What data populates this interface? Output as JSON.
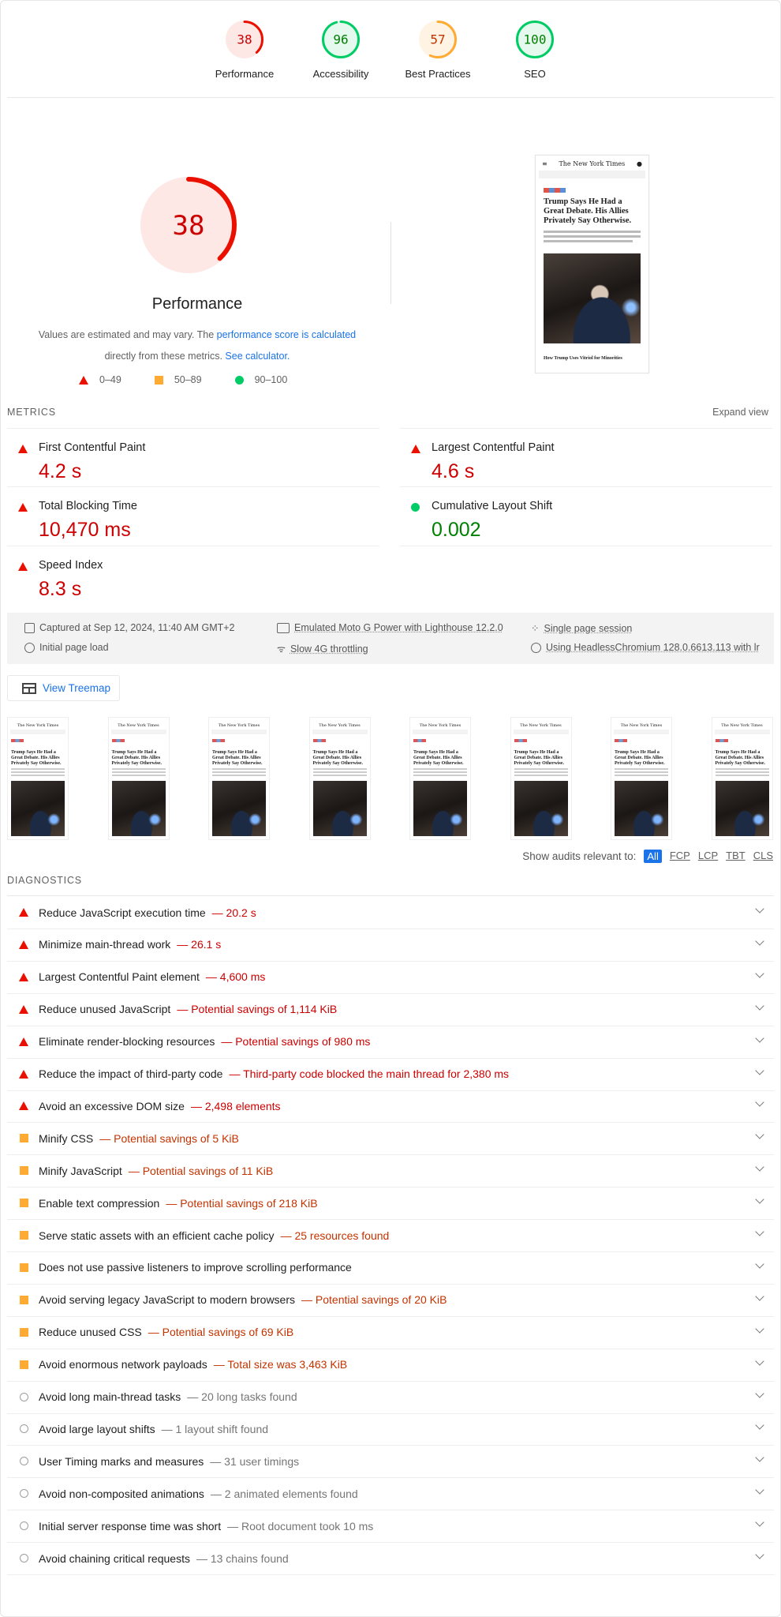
{
  "categories": [
    {
      "label": "Performance",
      "score": 38,
      "color": "#eb0f00",
      "bg": "#fde8e6",
      "text": "#c00"
    },
    {
      "label": "Accessibility",
      "score": 96,
      "color": "#0c6",
      "bg": "#e6f9ee",
      "text": "#008000"
    },
    {
      "label": "Best Practices",
      "score": 57,
      "color": "#fa3",
      "bg": "#fff4e4",
      "text": "#c33300"
    },
    {
      "label": "SEO",
      "score": 100,
      "color": "#0c6",
      "bg": "#e6f9ee",
      "text": "#008000"
    }
  ],
  "performance": {
    "score": 38,
    "title": "Performance",
    "desc_prefix": "Values are estimated and may vary. The ",
    "desc_link": "performance score is calculated",
    "desc_mid": "directly from these metrics.",
    "desc_link2": "See calculator.",
    "legend": [
      "0–49",
      "50–89",
      "90–100"
    ]
  },
  "screenshot": {
    "masthead": "The New York Times",
    "headline": "Trump Says He Had a Great Debate. His Allies Privately Say Otherwise.",
    "subhead": "How Trump Uses Vitriol for Minorities"
  },
  "metrics": {
    "label": "METRICS",
    "expand": "Expand view",
    "items": [
      {
        "name": "First Contentful Paint",
        "value": "4.2 s",
        "status": "fail"
      },
      {
        "name": "Largest Contentful Paint",
        "value": "4.6 s",
        "status": "fail"
      },
      {
        "name": "Total Blocking Time",
        "value": "10,470 ms",
        "status": "fail"
      },
      {
        "name": "Cumulative Layout Shift",
        "value": "0.002",
        "status": "pass"
      },
      {
        "name": "Speed Index",
        "value": "8.3 s",
        "status": "fail"
      }
    ]
  },
  "env": {
    "captured": "Captured at Sep 12, 2024, 11:40 AM GMT+2",
    "device": "Emulated Moto G Power with Lighthouse 12.2.0",
    "session": "Single page session",
    "load": "Initial page load",
    "throttling": "Slow 4G throttling",
    "browser": "Using HeadlessChromium 128.0.6613.113 with lr"
  },
  "treemap_label": "View Treemap",
  "filter": {
    "label": "Show audits relevant to:",
    "options": [
      "All",
      "FCP",
      "LCP",
      "TBT",
      "CLS"
    ],
    "selected": "All"
  },
  "diagnostics": {
    "label": "DIAGNOSTICS",
    "items": [
      {
        "title": "Reduce JavaScript execution time",
        "detail": "— 20.2 s",
        "status": "fail"
      },
      {
        "title": "Minimize main-thread work",
        "detail": "— 26.1 s",
        "status": "fail"
      },
      {
        "title": "Largest Contentful Paint element",
        "detail": "— 4,600 ms",
        "status": "fail"
      },
      {
        "title": "Reduce unused JavaScript",
        "detail": "— Potential savings of 1,114 KiB",
        "status": "fail"
      },
      {
        "title": "Eliminate render-blocking resources",
        "detail": "— Potential savings of 980 ms",
        "status": "fail"
      },
      {
        "title": "Reduce the impact of third-party code",
        "detail": "— Third-party code blocked the main thread for 2,380 ms",
        "status": "fail"
      },
      {
        "title": "Avoid an excessive DOM size",
        "detail": "— 2,498 elements",
        "status": "fail"
      },
      {
        "title": "Minify CSS",
        "detail": "— Potential savings of 5 KiB",
        "status": "average"
      },
      {
        "title": "Minify JavaScript",
        "detail": "— Potential savings of 11 KiB",
        "status": "average"
      },
      {
        "title": "Enable text compression",
        "detail": "— Potential savings of 218 KiB",
        "status": "average"
      },
      {
        "title": "Serve static assets with an efficient cache policy",
        "detail": "— 25 resources found",
        "status": "average"
      },
      {
        "title": "Does not use passive listeners to improve scrolling performance",
        "detail": "",
        "status": "average"
      },
      {
        "title": "Avoid serving legacy JavaScript to modern browsers",
        "detail": "— Potential savings of 20 KiB",
        "status": "average"
      },
      {
        "title": "Reduce unused CSS",
        "detail": "— Potential savings of 69 KiB",
        "status": "average"
      },
      {
        "title": "Avoid enormous network payloads",
        "detail": "— Total size was 3,463 KiB",
        "status": "average"
      },
      {
        "title": "Avoid long main-thread tasks",
        "detail": "— 20 long tasks found",
        "status": "info"
      },
      {
        "title": "Avoid large layout shifts",
        "detail": "— 1 layout shift found",
        "status": "info"
      },
      {
        "title": "User Timing marks and measures",
        "detail": "— 31 user timings",
        "status": "info"
      },
      {
        "title": "Avoid non-composited animations",
        "detail": "— 2 animated elements found",
        "status": "info"
      },
      {
        "title": "Initial server response time was short",
        "detail": "— Root document took 10 ms",
        "status": "info"
      },
      {
        "title": "Avoid chaining critical requests",
        "detail": "— 13 chains found",
        "status": "info"
      }
    ]
  }
}
